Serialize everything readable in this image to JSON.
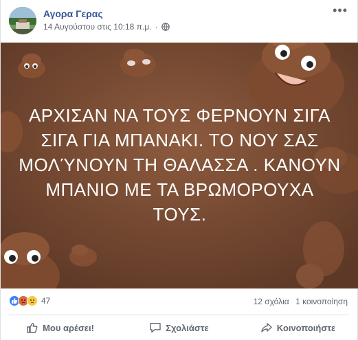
{
  "post": {
    "author": "Αγορα Γερας",
    "timestamp": "14 Αυγούστου στις 10:18 π.μ.",
    "privacy_icon": "globe-icon",
    "more_label": "•••",
    "text": "ΑΡΧΙΣΑΝ ΝΑ ΤΟΥΣ ΦΕΡΝΟΥΝ ΣΙΓΑ ΣΙΓΑ ΓΙΑ ΜΠΑΝΑΚΙ. ΤΟ ΝΟΥ ΣΑΣ ΜΟΛΎΝΟΥΝ ΤΗ ΘΑΛΑΣΣΑ . ΚΑΝΟΥΝ ΜΠΑΝΙΟ ΜΕ ΤΑ ΒΡΩΜΟΡΟΥΧΑ ΤΟΥΣ.",
    "background_color": "#7a4c33"
  },
  "stats": {
    "reaction_count": "47",
    "comments": "12 σχόλια",
    "shares": "1 κοινοποίηση"
  },
  "actions": {
    "like": "Μου αρέσει!",
    "comment": "Σχολιάστε",
    "share": "Κοινοποιήστε"
  },
  "colors": {
    "author_link": "#365899",
    "meta_text": "#606770"
  }
}
